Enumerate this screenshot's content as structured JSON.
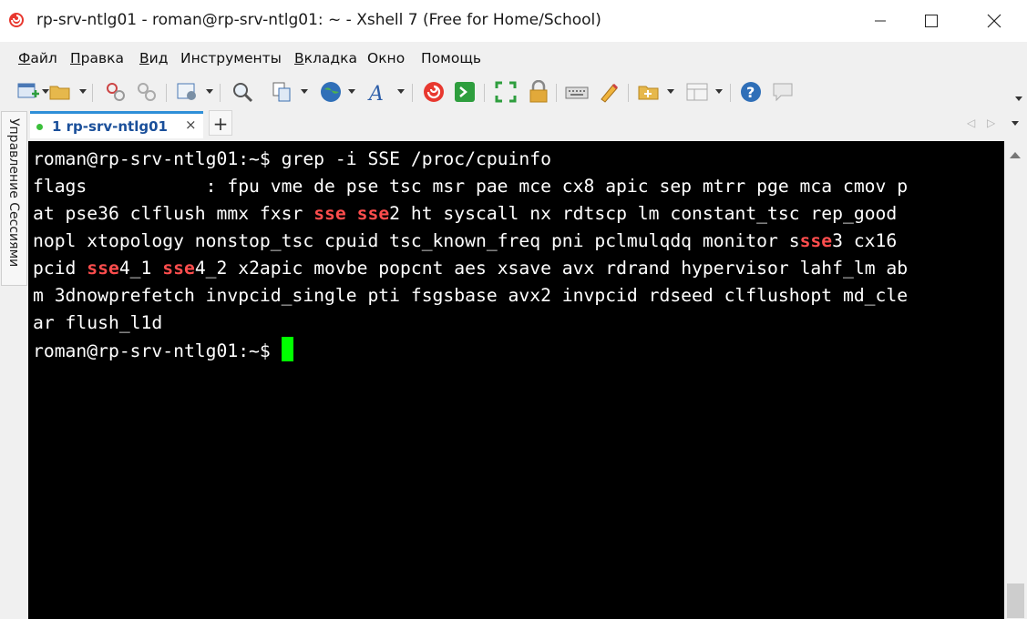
{
  "window": {
    "title": "rp-srv-ntlg01 - roman@rp-srv-ntlg01: ~ - Xshell 7 (Free for Home/School)",
    "icon": "xshell-logo-icon",
    "controls": [
      "minimize-icon",
      "maximize-icon",
      "close-icon"
    ]
  },
  "menu": {
    "items": [
      {
        "key": "Ф",
        "rest": "айл"
      },
      {
        "key": "П",
        "rest": "равка"
      },
      {
        "key": "В",
        "rest": "ид"
      },
      {
        "key": "",
        "rest": "Инструменты"
      },
      {
        "key": "В",
        "rest": "кладка"
      },
      {
        "key": "",
        "rest": "Окно"
      },
      {
        "key": "",
        "rest": "Помощь"
      }
    ]
  },
  "toolbar": {
    "icons": [
      "new-session-icon",
      "open-folder-icon",
      "disconnect-icon",
      "reconnect-icon",
      "properties-icon",
      "find-icon",
      "copy-paste-icon",
      "globe-icon",
      "font-icon",
      "xftp-icon",
      "xshell-icon",
      "fullscreen-icon",
      "lock-icon",
      "keyboard-icon",
      "highlight-icon",
      "new-tab-icon",
      "layout-icon",
      "help-icon",
      "chat-icon"
    ]
  },
  "side_panel": {
    "label": "Управление Сессиями"
  },
  "tabs": {
    "active_label": "1 rp-srv-ntlg01",
    "close_glyph": "×",
    "add_glyph": "+"
  },
  "terminal": {
    "prompt": "roman@rp-srv-ntlg01:~$ ",
    "command": "grep -i SSE /proc/cpuinfo",
    "highlight": "sse",
    "output_lines": [
      [
        "flags           : fpu vme de pse tsc msr pae mce cx8 apic sep mtrr pge mca cmov p"
      ],
      [
        "at pse36 clflush mmx fxsr ",
        "sse",
        " ",
        "sse",
        "2 ht syscall nx rdtscp lm constant_tsc rep_good"
      ],
      [
        "nopl xtopology nonstop_tsc cpuid tsc_known_freq pni pclmulqdq monitor s",
        "sse",
        "3 cx16"
      ],
      [
        "pcid ",
        "sse",
        "4_1 ",
        "sse",
        "4_2 x2apic movbe popcnt aes xsave avx rdrand hypervisor lahf_lm ab"
      ],
      [
        "m 3dnowprefetch invpcid_single pti fsgsbase avx2 invpcid rdseed clflushopt md_cle"
      ],
      [
        "ar flush_l1d"
      ]
    ],
    "colors": {
      "background": "#000000",
      "text": "#ffffff",
      "match": "#ff4d4d",
      "cursor": "#00ff00"
    }
  }
}
